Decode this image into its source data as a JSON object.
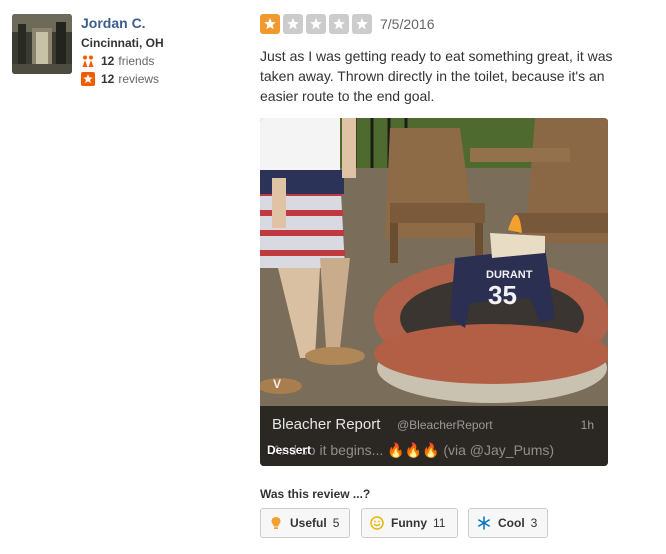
{
  "user": {
    "name": "Jordan C.",
    "location": "Cincinnati, OH",
    "friends_count": "12",
    "friends_label": "friends",
    "reviews_count": "12",
    "reviews_label": "reviews",
    "friends_icon": "friends-icon",
    "reviews_icon": "star-badge-icon"
  },
  "review": {
    "rating": 1,
    "max_rating": 5,
    "date": "7/5/2016",
    "text": "Just as I was getting ready to eat something great, it was taken away. Thrown directly in the toilet, because it's an easier route to the end goal.",
    "star_color_active": "#f0992e",
    "star_color_inactive": "#cccccc"
  },
  "media": {
    "jersey_text": "DURANT",
    "jersey_number": "35",
    "vine_mark": "V",
    "tweet_name": "Bleacher Report",
    "tweet_handle": "@BleacherReport",
    "tweet_time": "1h",
    "tweet_text": "And so it begins... 🔥🔥🔥 (via @Jay_Pums)",
    "caption": "Dessert"
  },
  "feedback": {
    "question": "Was this review ...?",
    "buttons": [
      {
        "label": "Useful",
        "count": "5",
        "icon": "lightbulb-icon"
      },
      {
        "label": "Funny",
        "count": "11",
        "icon": "smiley-icon"
      },
      {
        "label": "Cool",
        "count": "3",
        "icon": "snowflake-icon"
      }
    ]
  },
  "colors": {
    "link_blue": "#3b5e8c",
    "star_orange": "#f0992e",
    "friends_orange": "#f15c00",
    "reviews_orange": "#f15c00",
    "snowflake_blue": "#0073bb",
    "smiley_yellow": "#e8b80a"
  }
}
